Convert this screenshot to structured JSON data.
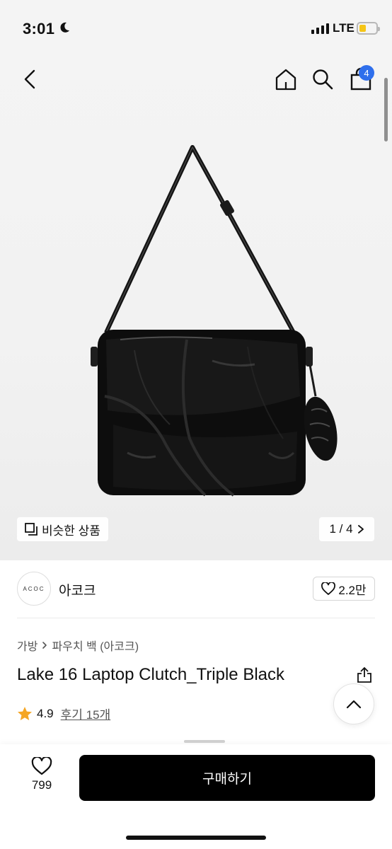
{
  "status_bar": {
    "time": "3:01",
    "network": "LTE"
  },
  "nav": {
    "cart_count": "4"
  },
  "gallery": {
    "similar_label": "비슷한 상품",
    "page": "1 / 4"
  },
  "brand": {
    "logo_text": "ACOC",
    "name": "아코크",
    "likes": "2.2만"
  },
  "product": {
    "breadcrumb": [
      "가방",
      "파우치 백 (아코크)"
    ],
    "title": "Lake 16 Laptop Clutch_Triple Black",
    "rating": "4.9",
    "reviews_label": "후기 15개"
  },
  "bottom": {
    "wish_count": "799",
    "buy_label": "구매하기"
  },
  "colors": {
    "accent": "#2f6fec",
    "star": "#f5a623",
    "buy_bg": "#000000"
  },
  "icons": [
    "moon-icon",
    "back-icon",
    "home-icon",
    "search-icon",
    "shopping-bag-icon",
    "similar-icon",
    "chevron-right-icon",
    "heart-icon",
    "share-icon",
    "star-icon",
    "chevron-up-icon"
  ]
}
